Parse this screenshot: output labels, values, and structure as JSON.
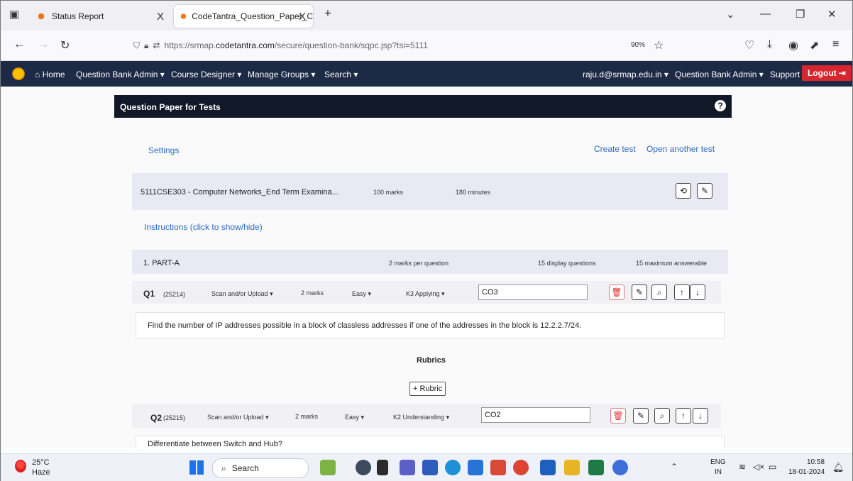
{
  "browser": {
    "tabs": [
      {
        "title": "Status Report",
        "close": "X"
      },
      {
        "title": "CodeTantra_Question_Paper_C",
        "close": "X"
      }
    ],
    "new_tab": "+",
    "url_prefix": "https://srmap.",
    "url_host": "codetantra.com",
    "url_path": "/secure/question-bank/sqpc.jsp?tsi=5111",
    "zoom": "90%"
  },
  "appnav": {
    "home": "Home",
    "menus": [
      "Question Bank Admin",
      "Course Designer",
      "Manage Groups",
      "Search"
    ],
    "user": "raju.d@srmap.edu.in",
    "role": "Question Bank Admin",
    "support": "Support",
    "logout": "Logout"
  },
  "panel": {
    "title": "Question Paper for Tests",
    "help": "?",
    "settings": "Settings",
    "create_test": "Create test",
    "open_another": "Open another test"
  },
  "test": {
    "name": "5111CSE303 - Computer Networks_End Term Examina...",
    "marks": "100 marks",
    "minutes": "180 minutes",
    "instructions": "Instructions (click to show/hide)"
  },
  "section": {
    "name": "1. PART-A",
    "marks_per_q": "2 marks per question",
    "display": "15 display questions",
    "max": "15 maximum answerable"
  },
  "questions": [
    {
      "label": "Q1",
      "id": "(25214)",
      "type": "Scan and/or Upload",
      "marks": "2 marks",
      "level": "Easy",
      "bloom": "K3 Applying",
      "co": "CO3",
      "text": "Find the number of IP addresses possible in a block of classless addresses if one of the addresses in the block is 12.2.2.7/24."
    },
    {
      "label": "Q2",
      "id": "(25215)",
      "type": "Scan and/or Upload",
      "marks": "2 marks",
      "level": "Easy",
      "bloom": "K2 Understanding",
      "co": "CO2",
      "text": "Differentiate between Switch and Hub?"
    }
  ],
  "rubrics": {
    "title": "Rubrics",
    "add": "+ Rubric"
  },
  "taskbar": {
    "temp": "25°C",
    "weather": "Haze",
    "search": "Search",
    "lang1": "ENG",
    "lang2": "IN",
    "time": "10:58",
    "date": "18-01-2024"
  },
  "colors": {
    "nav": "#1d2a45",
    "logout": "#d7262f",
    "link": "#2d6bc4"
  }
}
